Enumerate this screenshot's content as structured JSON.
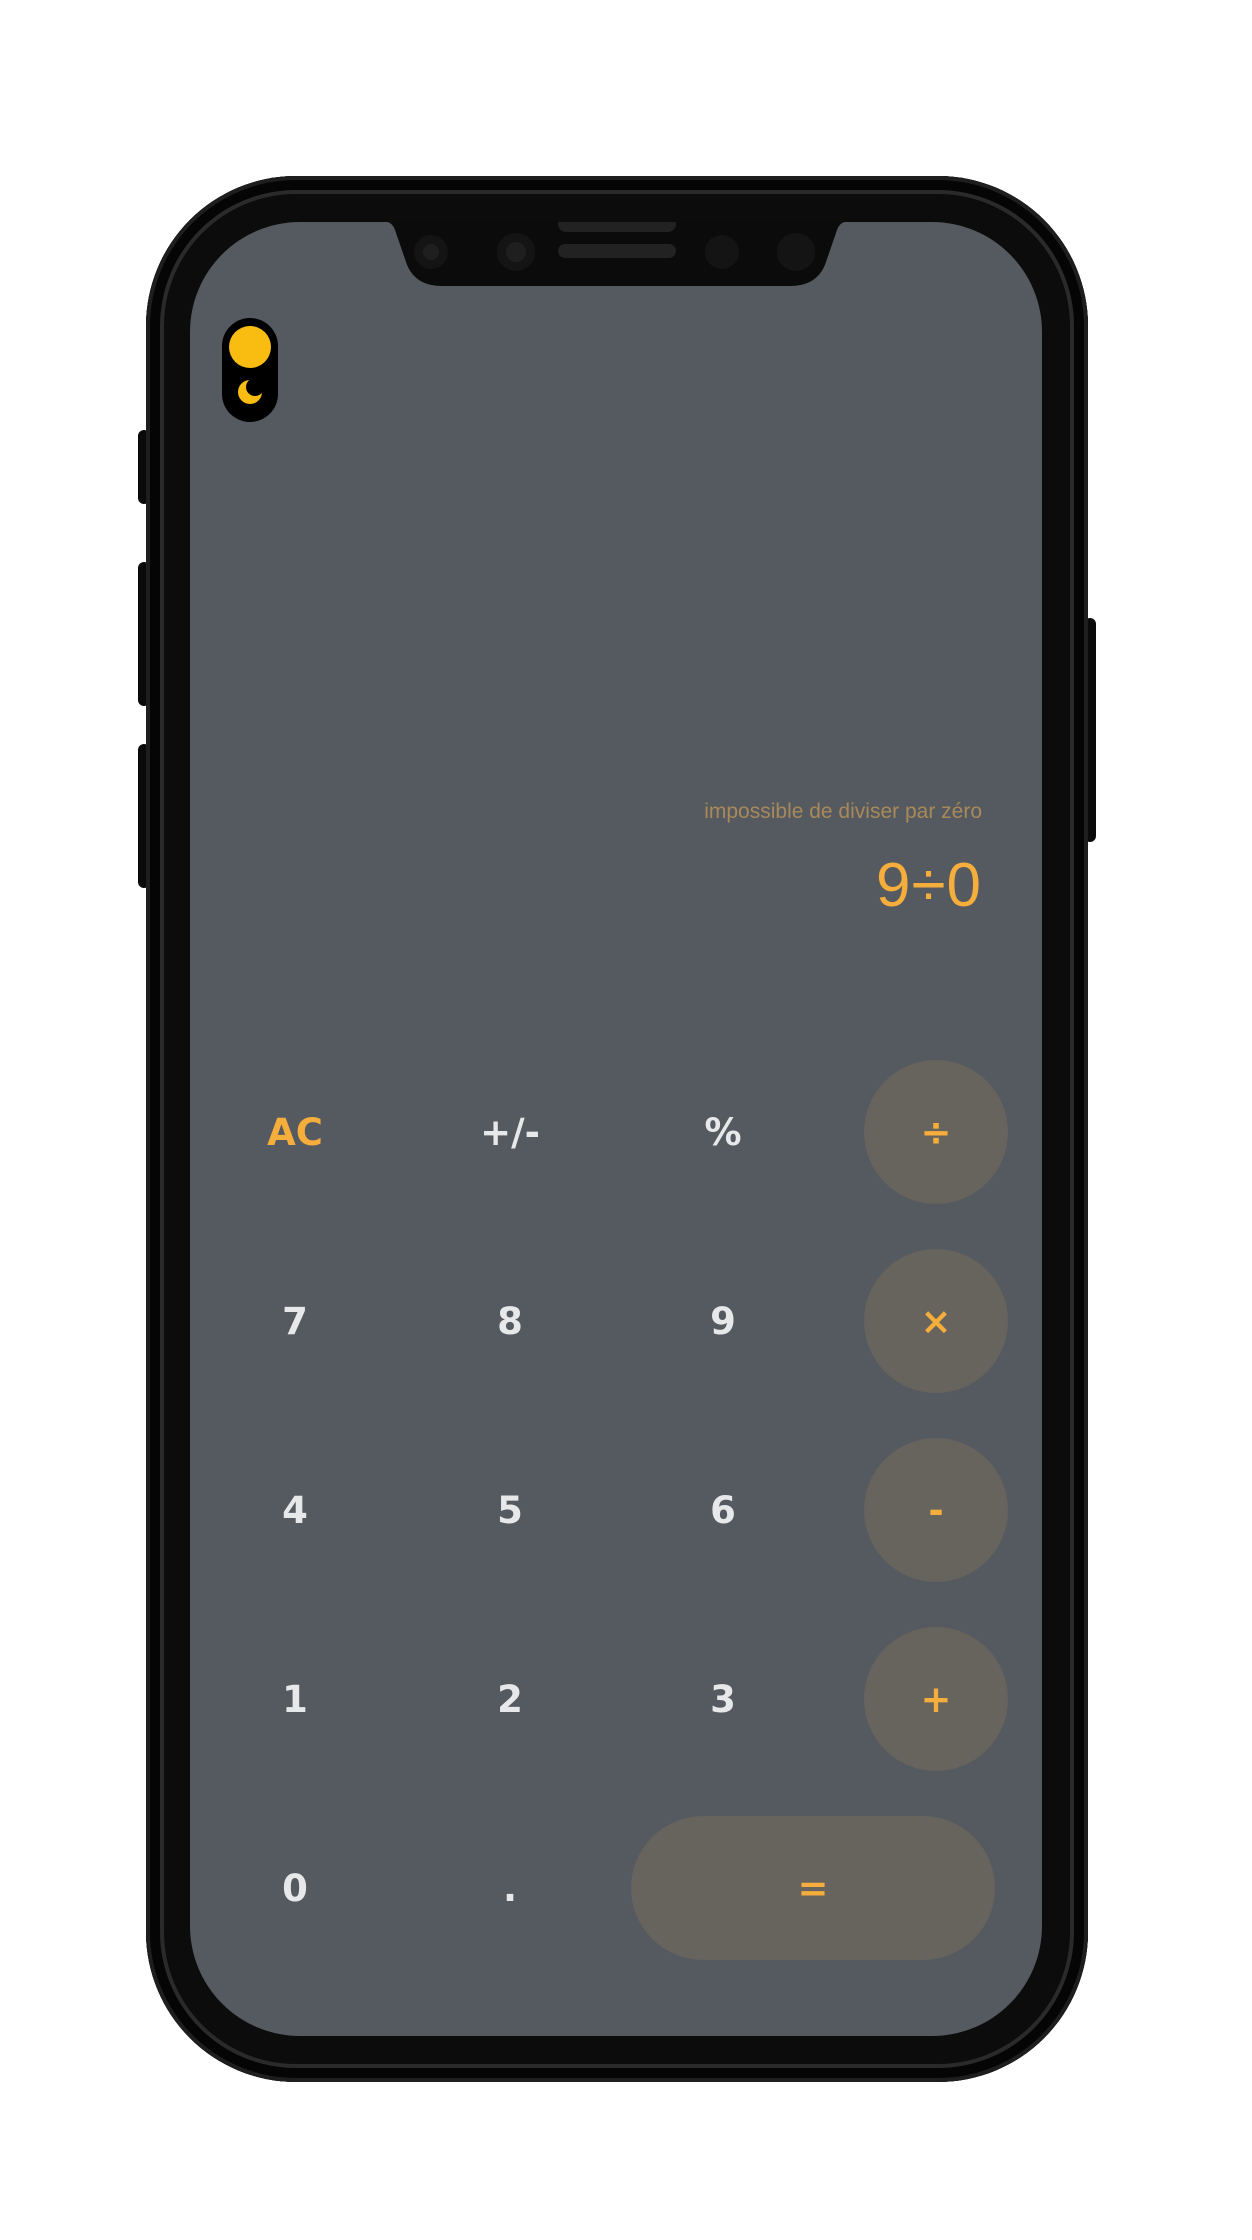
{
  "display": {
    "message": "impossible de diviser par zéro",
    "expression": "9÷0"
  },
  "colors": {
    "screen_bg": "#555a60",
    "accent": "#f5ad3c",
    "toggle_sun": "#f8bd10",
    "operator_bg": "#67635d",
    "key_text": "#e7e8ea"
  },
  "theme_toggle": {
    "sun_icon": "sun-icon",
    "moon_icon": "moon-icon"
  },
  "keypad": {
    "ac": "AC",
    "sign": "+/-",
    "percent": "%",
    "divide": "÷",
    "seven": "7",
    "eight": "8",
    "nine": "9",
    "multiply": "×",
    "four": "4",
    "five": "5",
    "six": "6",
    "subtract": "-",
    "one": "1",
    "two": "2",
    "three": "3",
    "add": "+",
    "zero": "0",
    "decimal": ".",
    "equals": "="
  }
}
